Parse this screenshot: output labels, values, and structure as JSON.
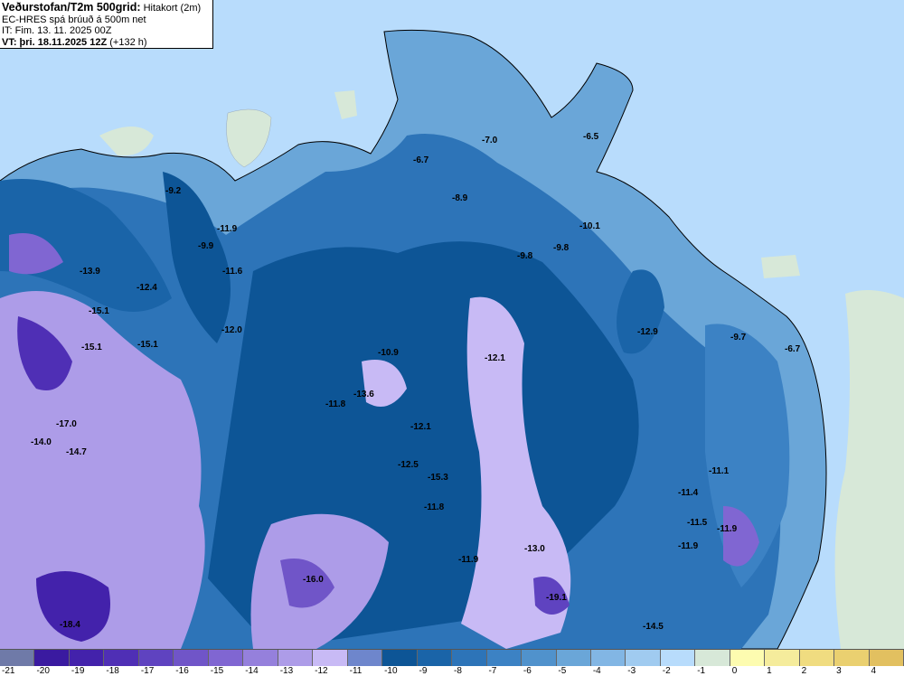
{
  "header": {
    "title_bold": "Veðurstofan/T2m 500grid:",
    "title_rest": "Hitakort (2m)",
    "model": "EC-HRES spá brúuð á 500m net",
    "init_time": "IT: Fim. 13. 11. 2025 00Z",
    "valid_time_bold": "VT: þri. 18.11.2025 12Z",
    "valid_time_rest": "(+132 h)"
  },
  "legend": {
    "labels": [
      "-21",
      "-20",
      "-19",
      "-18",
      "-17",
      "-16",
      "-15",
      "-14",
      "-13",
      "-12",
      "-11",
      "-10",
      "-9",
      "-8",
      "-7",
      "-6",
      "-5",
      "-4",
      "-3",
      "-2",
      "-1",
      "0",
      "1",
      "2",
      "3",
      "4"
    ],
    "colors": [
      "#6f7aa8",
      "#3a1aa0",
      "#4322ab",
      "#4f2fb5",
      "#5f43c0",
      "#7055c8",
      "#8066d2",
      "#9580dc",
      "#ad9ce8",
      "#c8baf5",
      "#6e86cc",
      "#0d5596",
      "#1a64a8",
      "#2d74b8",
      "#3c82c4",
      "#5092cc",
      "#6aa6d8",
      "#82b6e4",
      "#a0cbf0",
      "#b8dcfc",
      "#d7e8d8",
      "#fdfcb0",
      "#f5ec9c",
      "#f0dc80",
      "#ead070",
      "#e2c060"
    ]
  },
  "map": {
    "sea_color": "#b8dcfc",
    "values": [
      "-7.0",
      "-6.5",
      "-6.7",
      "-8.9",
      "-10.1",
      "-9.8",
      "-9.8",
      "-9.2",
      "-11.9",
      "-9.9",
      "-11.6",
      "-13.9",
      "-12.4",
      "-15.1",
      "-15.1",
      "-15.1",
      "-12.0",
      "-10.9",
      "-12.1",
      "-13.6",
      "-11.8",
      "-12.1",
      "-17.0",
      "-14.0",
      "-14.7",
      "-12.5",
      "-15.3",
      "-11.8",
      "-12.9",
      "-9.7",
      "-6.7",
      "-11.1",
      "-11.4",
      "-11.5",
      "-11.9",
      "-11.9",
      "-13.0",
      "-11.9",
      "-16.0",
      "-19.1",
      "-18.4",
      "-14.5"
    ]
  }
}
